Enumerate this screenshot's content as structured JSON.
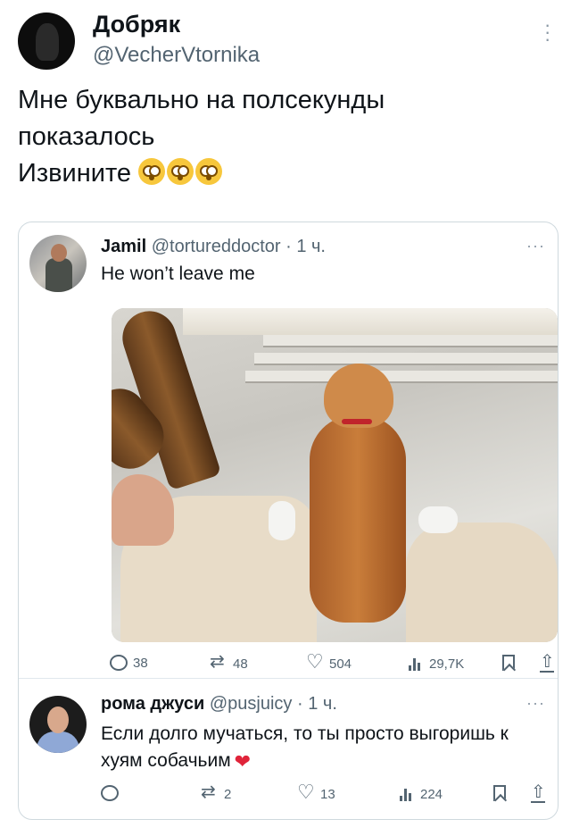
{
  "tweet": {
    "author_name": "Добряк",
    "author_handle": "@VecherVtornika",
    "text_line1": "Мне буквально на полсекунды",
    "text_line2": "показалось",
    "text_line3": "Извините",
    "emoji": "flushed-face-emoji"
  },
  "quoted": {
    "name": "Jamil",
    "handle": "@tortureddoctor",
    "time": "· 1 ч.",
    "text": "He won’t leave me",
    "more": "···",
    "image": "golden-retriever-between-legs-photo",
    "stats": {
      "replies": "38",
      "retweets": "48",
      "likes": "504",
      "views": "29,7K"
    }
  },
  "reply": {
    "name": "рома джуси",
    "handle": "@pusjuicy",
    "time": "· 1 ч.",
    "text": "Если долго мучаться, то ты просто выгоришь к хуям собачьим",
    "emoji": "❤",
    "more": "···",
    "stats": {
      "replies": "",
      "retweets": "2",
      "likes": "13",
      "views": "224"
    }
  },
  "colors": {
    "text": "#0f1419",
    "muted": "#536471",
    "border": "#cfd9de",
    "heart": "#e0243a"
  }
}
